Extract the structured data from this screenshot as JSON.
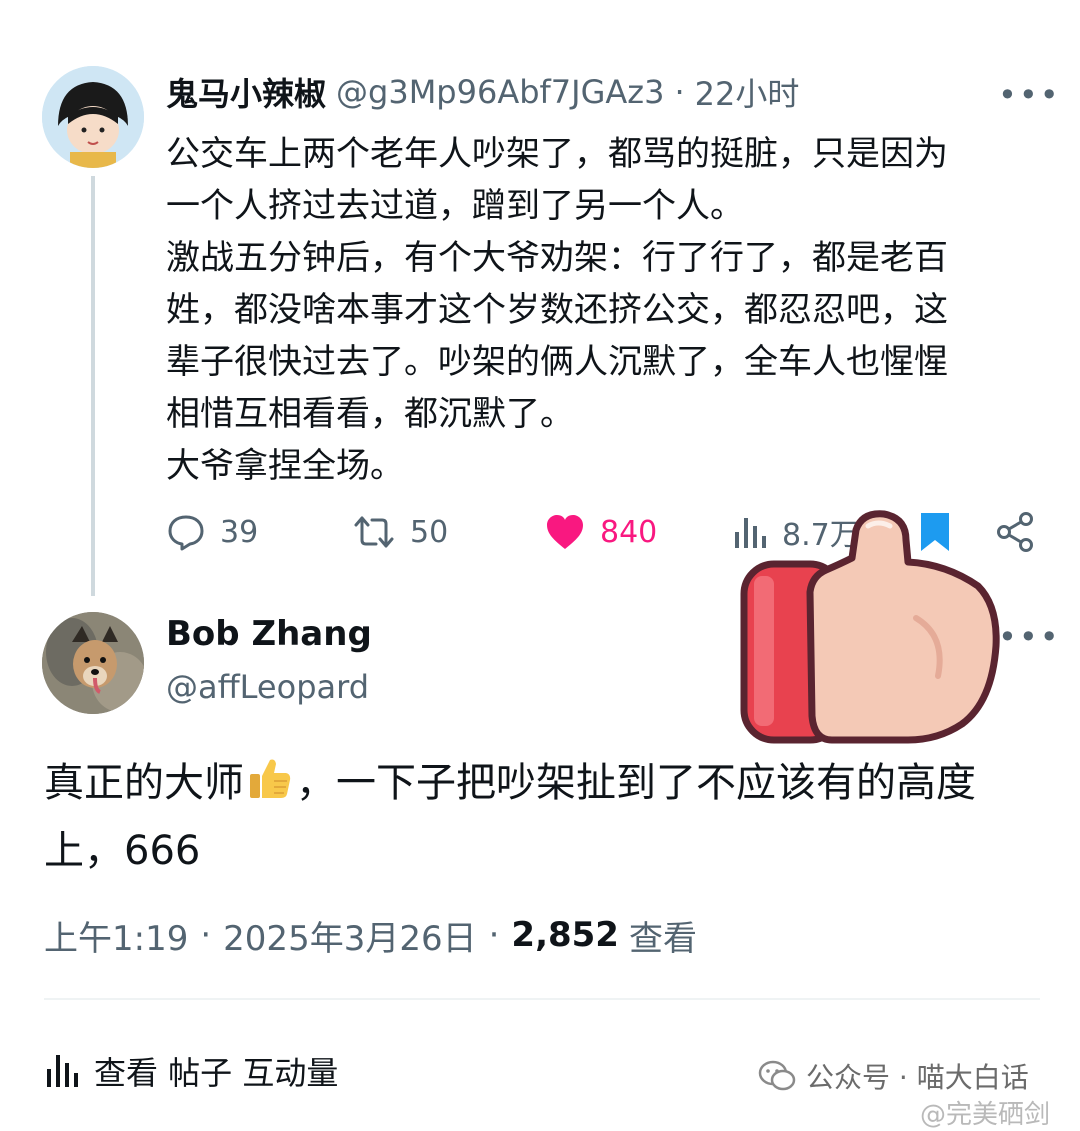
{
  "tweet1": {
    "author_name": "鬼马小辣椒",
    "handle": "@g3Mp96Abf7JGAz3",
    "separator": "·",
    "time": "22小时",
    "more": "•••",
    "lines": [
      "公交车上两个老年人吵架了，都骂的挺脏，只是因为",
      "一个人挤过去过道，蹭到了另一个人。",
      "激战五分钟后，有个大爷劝架：行了行了，都是老百",
      "姓，都没啥本事才这个岁数还挤公交，都忍忍吧，这",
      "辈子很快过去了。吵架的俩人沉默了，全车人也惺惺",
      "相惜互相看看，都沉默了。",
      "大爷拿捏全场。"
    ],
    "actions": {
      "replies": "39",
      "retweets": "50",
      "likes": "840",
      "views": "8.7万"
    }
  },
  "reply": {
    "author_name": "Bob Zhang",
    "handle": "@affLeopard",
    "more": "•••",
    "line1_before_emoji": "真正的大师",
    "line1_after_emoji": "，一下子把吵架扯到了不应该有的高度",
    "line2": "上，666",
    "meta": {
      "time": "上午1:19",
      "date": "2025年3月26日",
      "separator": "·",
      "view_count": "2,852",
      "view_label": "查看"
    }
  },
  "footer": {
    "label": "查看 帖子 互动量"
  },
  "watermark": {
    "text": "公众号 · 喵大白话",
    "text2": "@完美硒剑"
  },
  "colors": {
    "like": "#f91880",
    "bookmark": "#1d9bf0",
    "secondary_text": "#536471"
  }
}
